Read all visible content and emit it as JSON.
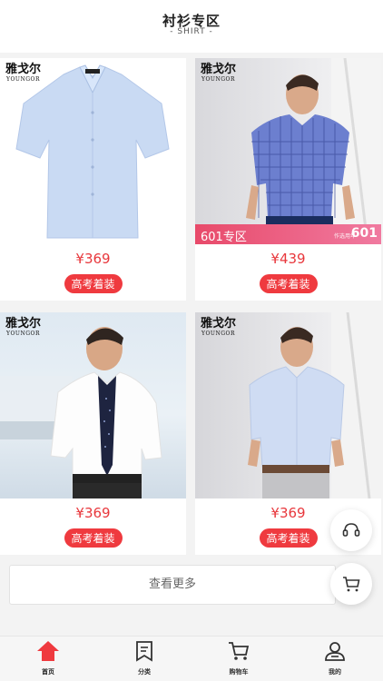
{
  "header": {
    "title": "衬衫专区",
    "subtitle": "- SHIRT -"
  },
  "brand": {
    "cn": "雅戈尔",
    "en": "YOUNGOR"
  },
  "products": [
    {
      "price": "¥369",
      "tag": "高考着装"
    },
    {
      "price": "¥439",
      "tag": "高考着装",
      "promo_zone": "601专区",
      "promo_small": "作选用年",
      "promo_num": "601"
    },
    {
      "price": "¥369",
      "tag": "高考着装"
    },
    {
      "price": "¥369",
      "tag": "高考着装"
    }
  ],
  "more_button": "查看更多",
  "tabs": [
    {
      "label": "首页",
      "icon": "home-icon",
      "active": true
    },
    {
      "label": "分类",
      "icon": "category-icon"
    },
    {
      "label": "购物车",
      "icon": "cart-icon"
    },
    {
      "label": "我的",
      "icon": "user-icon"
    }
  ],
  "colors": {
    "accent": "#ef3a3f",
    "price": "#e8373c",
    "promo": "#e84a6a"
  },
  "float_buttons": [
    "headset-icon",
    "cart-icon"
  ]
}
